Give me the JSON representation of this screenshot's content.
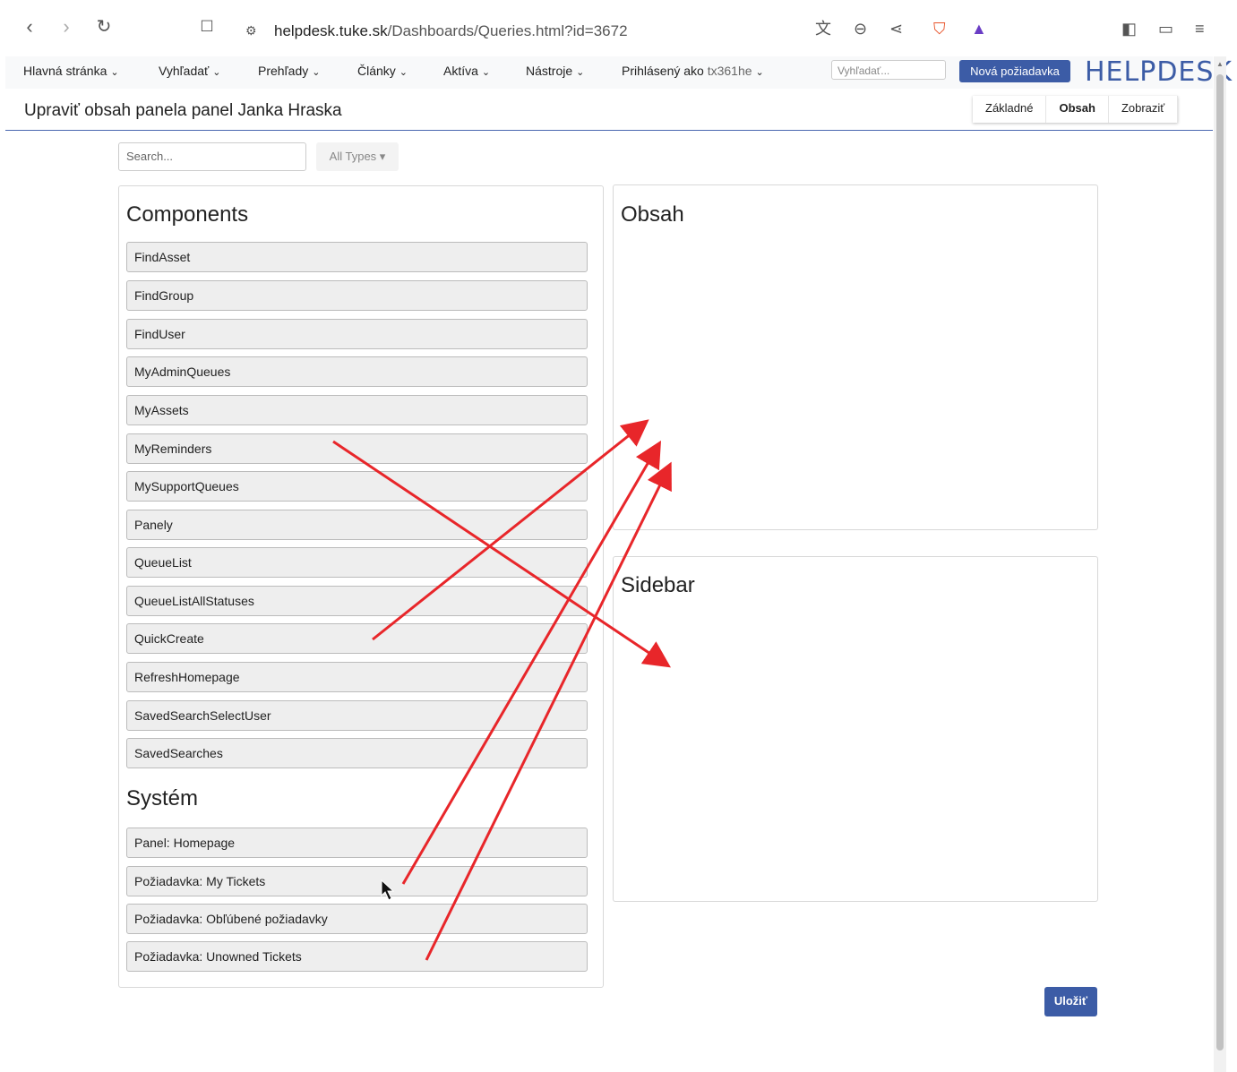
{
  "browser": {
    "url_host": "helpdesk.tuke.sk",
    "url_path": "/Dashboards/Queries.html?id=3672"
  },
  "nav": {
    "items": [
      "Hlavná stránka",
      "Vyhľadať",
      "Prehľady",
      "Články",
      "Aktíva",
      "Nástroje"
    ],
    "logged_label": "Prihlásený ako",
    "username": "tx361he",
    "search_placeholder": "Vyhľadať...",
    "new_request": "Nová požiadavka",
    "brand": "HELPDESK"
  },
  "page": {
    "title": "Upraviť obsah panela panel Janka Hraska",
    "tabs": [
      "Základné",
      "Obsah",
      "Zobraziť"
    ],
    "active_tab": "Obsah"
  },
  "filters": {
    "search_placeholder": "Search...",
    "types_label": "All Types ▾"
  },
  "components": {
    "heading": "Components",
    "items": [
      "FindAsset",
      "FindGroup",
      "FindUser",
      "MyAdminQueues",
      "MyAssets",
      "MyReminders",
      "MySupportQueues",
      "Panely",
      "QueueList",
      "QueueListAllStatuses",
      "QuickCreate",
      "RefreshHomepage",
      "SavedSearchSelectUser",
      "SavedSearches"
    ]
  },
  "system": {
    "heading": "Systém",
    "items": [
      "Panel: Homepage",
      "Požiadavka: My Tickets",
      "Požiadavka: Obľúbené požiadavky",
      "Požiadavka: Unowned Tickets"
    ]
  },
  "obsah": {
    "heading": "Obsah"
  },
  "sidebar": {
    "heading": "Sidebar"
  },
  "save_label": "Uložiť",
  "colors": {
    "accent": "#3c5ca6",
    "annotation": "#e8262a"
  }
}
